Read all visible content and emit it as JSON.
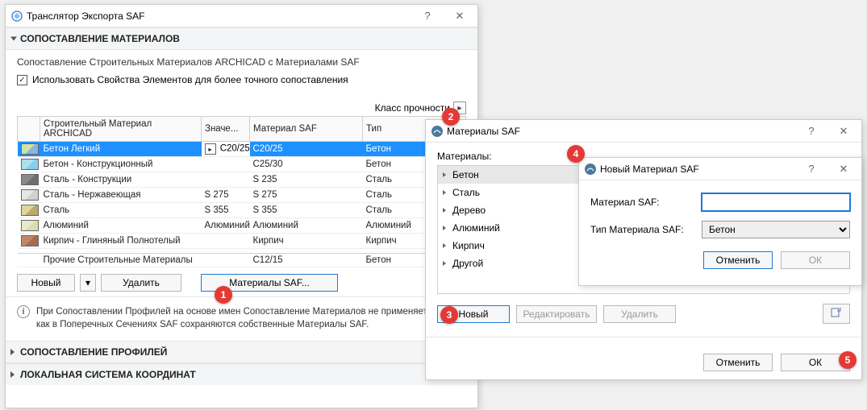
{
  "main": {
    "title": "Транслятор Экспорта SAF",
    "section_materials": "СОПОСТАВЛЕНИЕ МАТЕРИАЛОВ",
    "desc": "Сопоставление Строительных Материалов ARCHICAD с Материалами SAF",
    "use_props": "Использовать Свойства Элементов для более точного сопоставления",
    "strength_class": "Класс прочности",
    "cols": {
      "archicad": "Строительный Материал ARCHICAD",
      "value": "Значе...",
      "saf": "Материал SAF",
      "type": "Тип"
    },
    "rows": [
      {
        "name": "Бетон Легкий",
        "value": "C20/25",
        "saf": "C20/25",
        "type": "Бетон",
        "color1": "#cce5a8",
        "color2": "#8fb3d9",
        "selected": true,
        "picker": true
      },
      {
        "name": "Бетон - Конструкционный",
        "value": "",
        "saf": "C25/30",
        "type": "Бетон",
        "color1": "#b0e0e6",
        "color2": "#87ceeb"
      },
      {
        "name": "Сталь - Конструкции",
        "value": "",
        "saf": "S 235",
        "type": "Сталь",
        "color1": "#8a8a8a",
        "color2": "#6e6e6e"
      },
      {
        "name": "Сталь - Нержавеющая",
        "value": "S 275",
        "saf": "S 275",
        "type": "Сталь",
        "color1": "#e5e5e5",
        "color2": "#d0d0d0"
      },
      {
        "name": "Сталь",
        "value": "S 355",
        "saf": "S 355",
        "type": "Сталь",
        "color1": "#e0d699",
        "color2": "#bba86b"
      },
      {
        "name": "Алюминий",
        "value": "Алюминий",
        "saf": "Алюминий",
        "type": "Алюминий",
        "color1": "#e8e8d0",
        "color2": "#dcdcb0"
      },
      {
        "name": "Кирпич - Глиняный Полнотелый",
        "value": "",
        "saf": "Кирпич",
        "type": "Кирпич",
        "color1": "#c1876b",
        "color2": "#a56b4f"
      }
    ],
    "other_row": {
      "name": "Прочие Строительные Материалы",
      "value": "",
      "saf": "C12/15",
      "type": "Бетон"
    },
    "btn_new": "Новый",
    "btn_delete": "Удалить",
    "btn_saf": "Материалы SAF...",
    "info": "При Сопоставлении Профилей на основе имен Сопоставление Материалов не применяется, так как в Поперечных Сечениях SAF сохраняются собственные Материалы SAF.",
    "section_profiles": "СОПОСТАВЛЕНИЕ ПРОФИЛЕЙ",
    "section_coords": "ЛОКАЛЬНАЯ СИСТЕМА КООРДИНАТ"
  },
  "saf": {
    "title": "Материалы SAF",
    "label": "Материалы:",
    "items": [
      "Бетон",
      "Сталь",
      "Дерево",
      "Алюминий",
      "Кирпич",
      "Другой"
    ],
    "selected": 0,
    "btn_new": "Новый",
    "btn_edit": "Редактировать",
    "btn_delete": "Удалить",
    "btn_cancel": "Отменить",
    "btn_ok": "ОК"
  },
  "newmat": {
    "title": "Новый Материал SAF",
    "lbl_material": "Материал SAF:",
    "lbl_type": "Тип Материала SAF:",
    "val_material": "",
    "val_type": "Бетон",
    "btn_cancel": "Отменить",
    "btn_ok": "ОК"
  },
  "callouts": {
    "c1": "1",
    "c2": "2",
    "c3": "3",
    "c4": "4",
    "c5": "5"
  }
}
